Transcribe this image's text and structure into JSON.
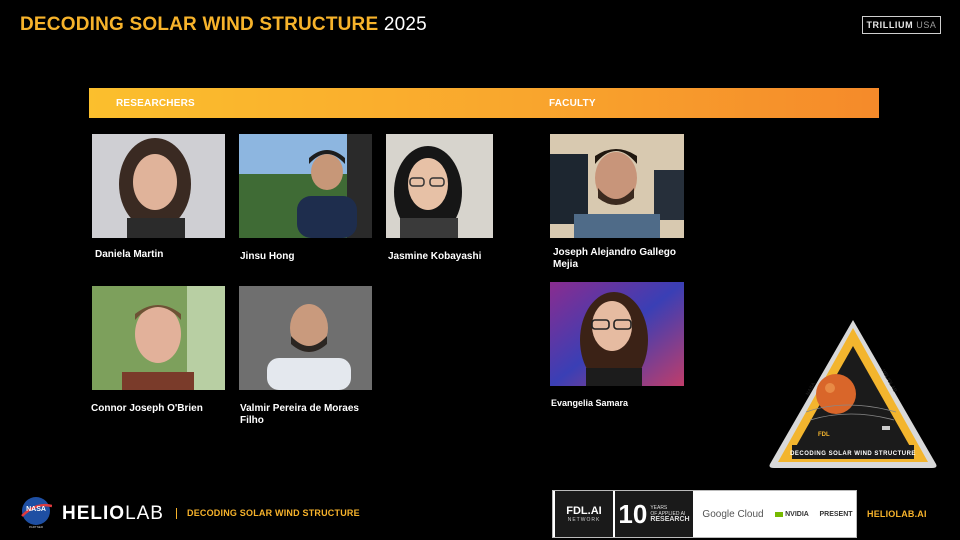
{
  "header": {
    "title_primary": "DECODING SOLAR WIND STRUCTURE",
    "title_year": "2025",
    "org_bold": "TRILLIUM",
    "org_light": "USA"
  },
  "band": {
    "researchers_label": "RESEARCHERS",
    "faculty_label": "FACULTY",
    "colors": [
      "#fbbf2d",
      "#f58a2a"
    ]
  },
  "researchers": [
    {
      "name": "Daniela Martin"
    },
    {
      "name": "Jinsu Hong"
    },
    {
      "name": "Jasmine Kobayashi"
    },
    {
      "name": "Connor Joseph O'Brien"
    },
    {
      "name_line1": "Valmir Pereira de Moraes",
      "name_line2": "Filho"
    }
  ],
  "faculty": [
    {
      "name_line1": "Joseph Alejandro Gallego",
      "name_line2": "Mejia"
    },
    {
      "name": "Evangelia Samara"
    }
  ],
  "badge": {
    "center_label": "FDL",
    "bottom_label": "DECODING SOLAR WIND STRUCTURE",
    "left_label": "NASA",
    "right_label": "HELIOLAB"
  },
  "footer": {
    "nasa_label": "NASA",
    "nasa_sub": "PARTNER",
    "brand_bold": "HELIO",
    "brand_light": "LAB",
    "project": "DECODING SOLAR WIND STRUCTURE",
    "url": "HELIOLAB.AI",
    "partners": {
      "fdl": "FDL.AI",
      "fdl_sub": "NETWORK",
      "ten": "10",
      "ten_sub1": "YEARS",
      "ten_sub2": "OF APPLIED AI",
      "ten_sub3": "RESEARCH",
      "google": "Google Cloud",
      "nvidia": "NVIDIA",
      "last": "PRESENT"
    }
  },
  "accent": "#f7b32b"
}
